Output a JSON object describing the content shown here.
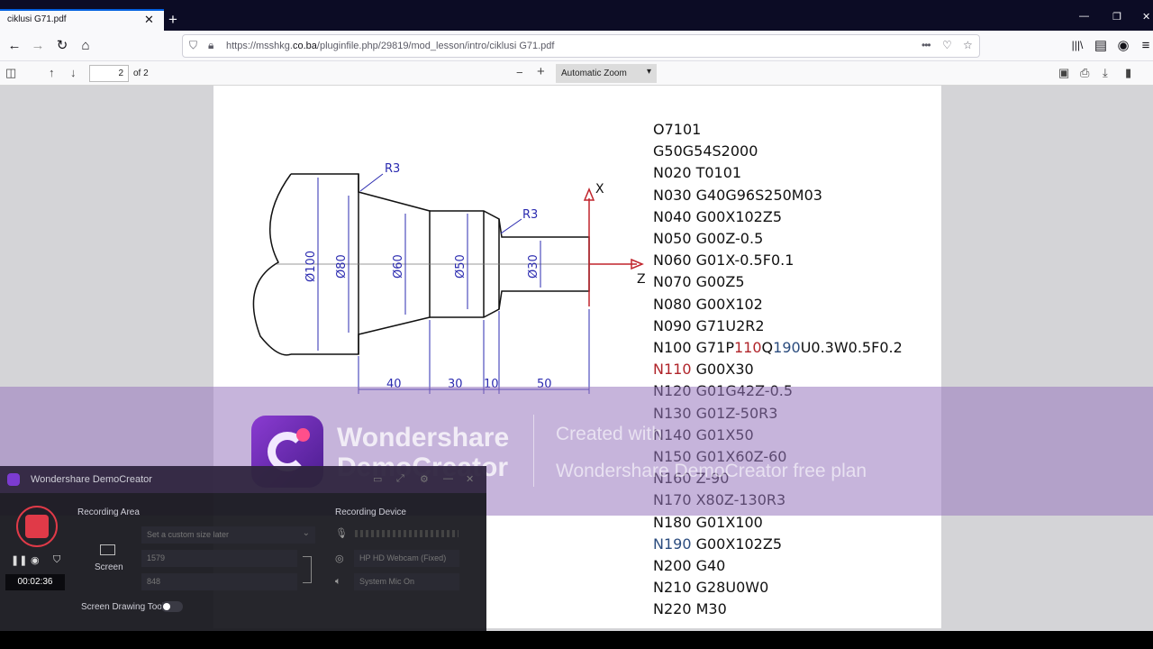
{
  "browser": {
    "tab_title": "ciklusi G71.pdf",
    "tab_close": "✕",
    "new_tab": "+",
    "url_prefix": "https://msshkg.",
    "url_domain": "co.ba",
    "url_path": "/pluginfile.php/29819/mod_lesson/intro/ciklusi G71.pdf",
    "menu_dots": "•••"
  },
  "pdf_toolbar": {
    "page_number": "2",
    "page_count": "of 2",
    "zoom": "Automatic Zoom"
  },
  "drawing": {
    "radius_left": "R3",
    "radius_right": "R3",
    "diameters": [
      "Ø100",
      "Ø80",
      "Ø60",
      "Ø50",
      "Ø30"
    ],
    "lengths": [
      "40",
      "30",
      "10",
      "50"
    ],
    "axis_x": "X",
    "axis_z": "Z"
  },
  "gcode": [
    {
      "parts": [
        {
          "t": "O7101",
          "c": ""
        }
      ]
    },
    {
      "parts": [
        {
          "t": "G50G54S2000",
          "c": ""
        }
      ]
    },
    {
      "parts": [
        {
          "t": "N020 T0101",
          "c": ""
        }
      ]
    },
    {
      "parts": [
        {
          "t": "N030 G40G96S250M03",
          "c": ""
        }
      ]
    },
    {
      "parts": [
        {
          "t": "N040 G00X102Z5",
          "c": ""
        }
      ]
    },
    {
      "parts": [
        {
          "t": "N050 G00Z-0.5",
          "c": ""
        }
      ]
    },
    {
      "parts": [
        {
          "t": "N060 G01X-0.5F0.1",
          "c": ""
        }
      ]
    },
    {
      "parts": [
        {
          "t": "N070 G00Z5",
          "c": ""
        }
      ]
    },
    {
      "parts": [
        {
          "t": "N080 G00X102",
          "c": ""
        }
      ]
    },
    {
      "parts": [
        {
          "t": "N090 G71U2R2",
          "c": ""
        }
      ]
    },
    {
      "parts": [
        {
          "t": "N100 G71P",
          "c": ""
        },
        {
          "t": "110",
          "c": "red"
        },
        {
          "t": "Q",
          "c": ""
        },
        {
          "t": "190",
          "c": "blue"
        },
        {
          "t": "U0.3W0.5F0.2",
          "c": ""
        }
      ]
    },
    {
      "parts": [
        {
          "t": "N110",
          "c": "red"
        },
        {
          "t": " G00X30",
          "c": ""
        }
      ]
    },
    {
      "parts": [
        {
          "t": "N120 G01G42Z-0.5",
          "c": ""
        }
      ]
    },
    {
      "parts": [
        {
          "t": "N130 G01Z-50R3",
          "c": ""
        }
      ]
    },
    {
      "parts": [
        {
          "t": "N140 G01X50",
          "c": ""
        }
      ]
    },
    {
      "parts": [
        {
          "t": "N150 G01X60Z-60",
          "c": ""
        }
      ]
    },
    {
      "parts": [
        {
          "t": "N160 Z-90",
          "c": ""
        }
      ]
    },
    {
      "parts": [
        {
          "t": "N170 X80Z-130R3",
          "c": ""
        }
      ]
    },
    {
      "parts": [
        {
          "t": "N180 G01X100",
          "c": ""
        }
      ]
    },
    {
      "parts": [
        {
          "t": "N190",
          "c": "blue"
        },
        {
          "t": " G00X102Z5",
          "c": ""
        }
      ]
    },
    {
      "parts": [
        {
          "t": "N200 G40",
          "c": ""
        }
      ]
    },
    {
      "parts": [
        {
          "t": "N210 G28U0W0",
          "c": ""
        }
      ]
    },
    {
      "parts": [
        {
          "t": "N220 M30",
          "c": ""
        }
      ]
    }
  ],
  "watermark": {
    "brand_line1": "Wondershare",
    "brand_line2": "DemoCreator",
    "created": "Created with",
    "plan": "Wondershare DemoCreator free plan"
  },
  "recorder": {
    "title": "Wondershare DemoCreator",
    "time": "00:02:36",
    "recording_area": "Recording Area",
    "screen": "Screen",
    "size_placeholder": "Set a custom size later",
    "width": "1579",
    "height": "848",
    "recording_device": "Recording Device",
    "webcam": "HP HD Webcam (Fixed)",
    "system_audio": "System Mic On",
    "drawing_tool": "Screen Drawing Tool"
  }
}
